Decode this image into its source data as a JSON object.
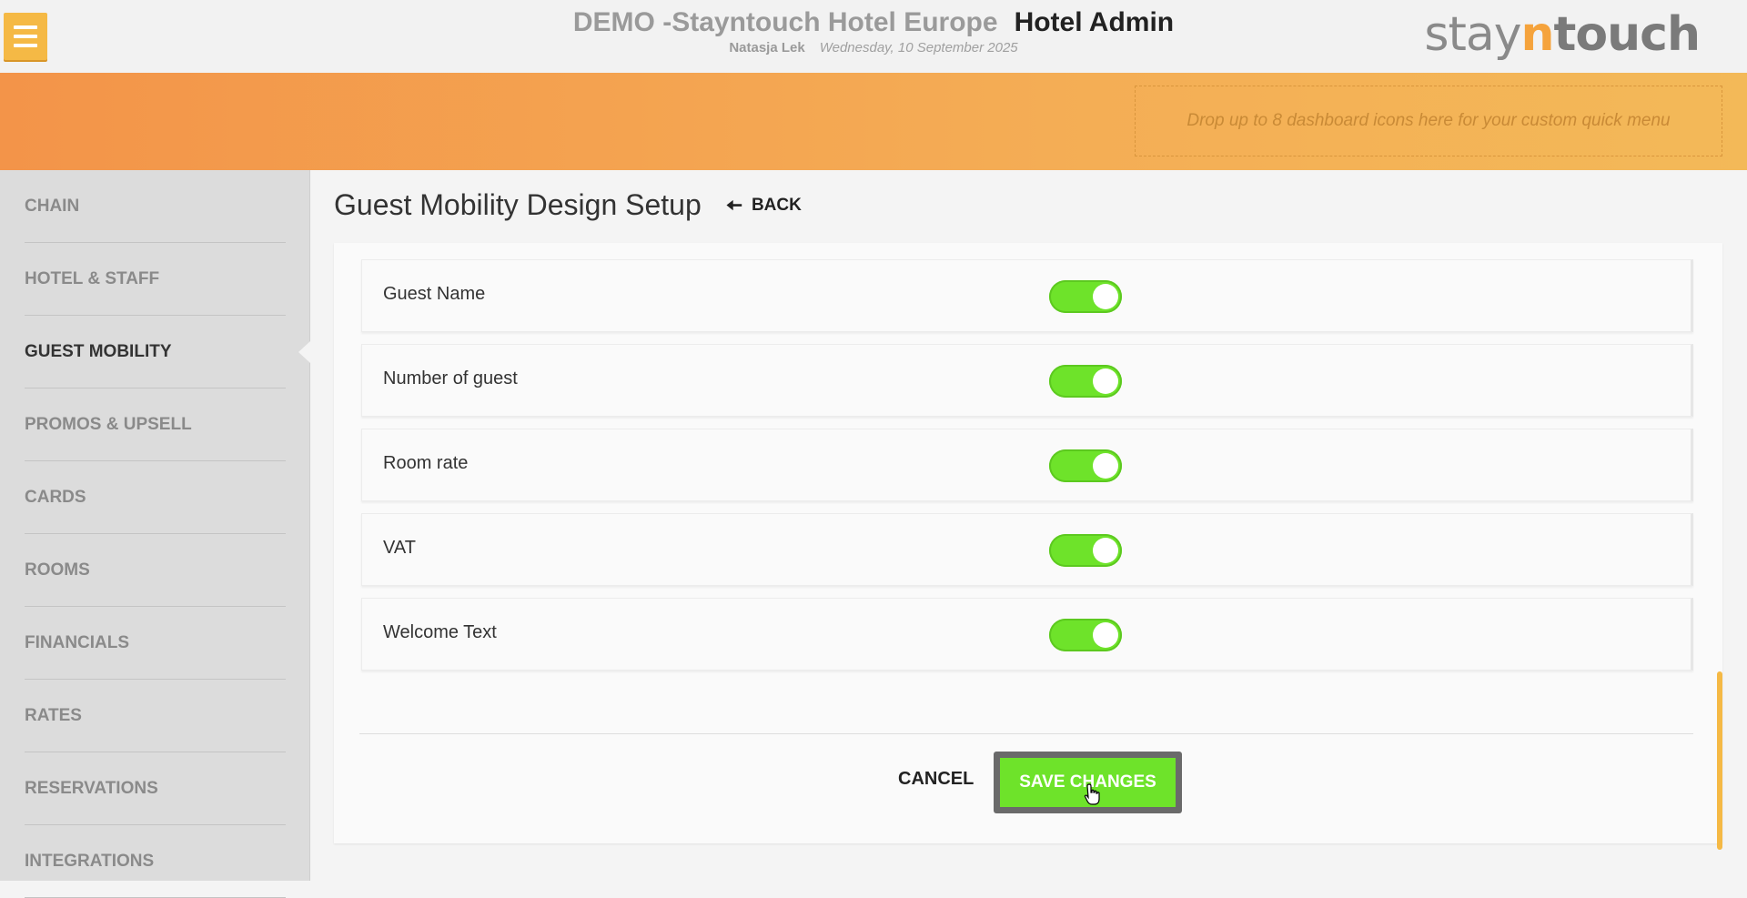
{
  "header": {
    "hotel_name": "DEMO -Stayntouch Hotel Europe",
    "app_title": "Hotel Admin",
    "user": "Natasja Lek",
    "date": "Wednesday, 10 September 2025",
    "logo_prefix": "stay",
    "logo_n": "n",
    "logo_suffix": "touch"
  },
  "quick_menu": {
    "placeholder": "Drop up to 8 dashboard icons here for your custom quick menu"
  },
  "sidebar": {
    "items": [
      {
        "label": "CHAIN"
      },
      {
        "label": "HOTEL & STAFF"
      },
      {
        "label": "GUEST MOBILITY",
        "active": true
      },
      {
        "label": "PROMOS & UPSELL"
      },
      {
        "label": "CARDS"
      },
      {
        "label": "ROOMS"
      },
      {
        "label": "FINANCIALS"
      },
      {
        "label": "RATES"
      },
      {
        "label": "RESERVATIONS"
      },
      {
        "label": "INTEGRATIONS"
      }
    ]
  },
  "page": {
    "title": "Guest Mobility Design Setup",
    "back_label": "BACK"
  },
  "settings": {
    "rows": [
      {
        "label": "Guest Name",
        "enabled": true
      },
      {
        "label": "Number of guest",
        "enabled": true
      },
      {
        "label": "Room rate",
        "enabled": true
      },
      {
        "label": "VAT",
        "enabled": true
      },
      {
        "label": "Welcome Text",
        "enabled": true
      }
    ]
  },
  "actions": {
    "cancel_label": "CANCEL",
    "save_label": "SAVE CHANGES"
  },
  "colors": {
    "accent": "#f5b945",
    "toggle_on": "#6ee32a",
    "band_start": "#f39449",
    "band_end": "#f3b958"
  }
}
